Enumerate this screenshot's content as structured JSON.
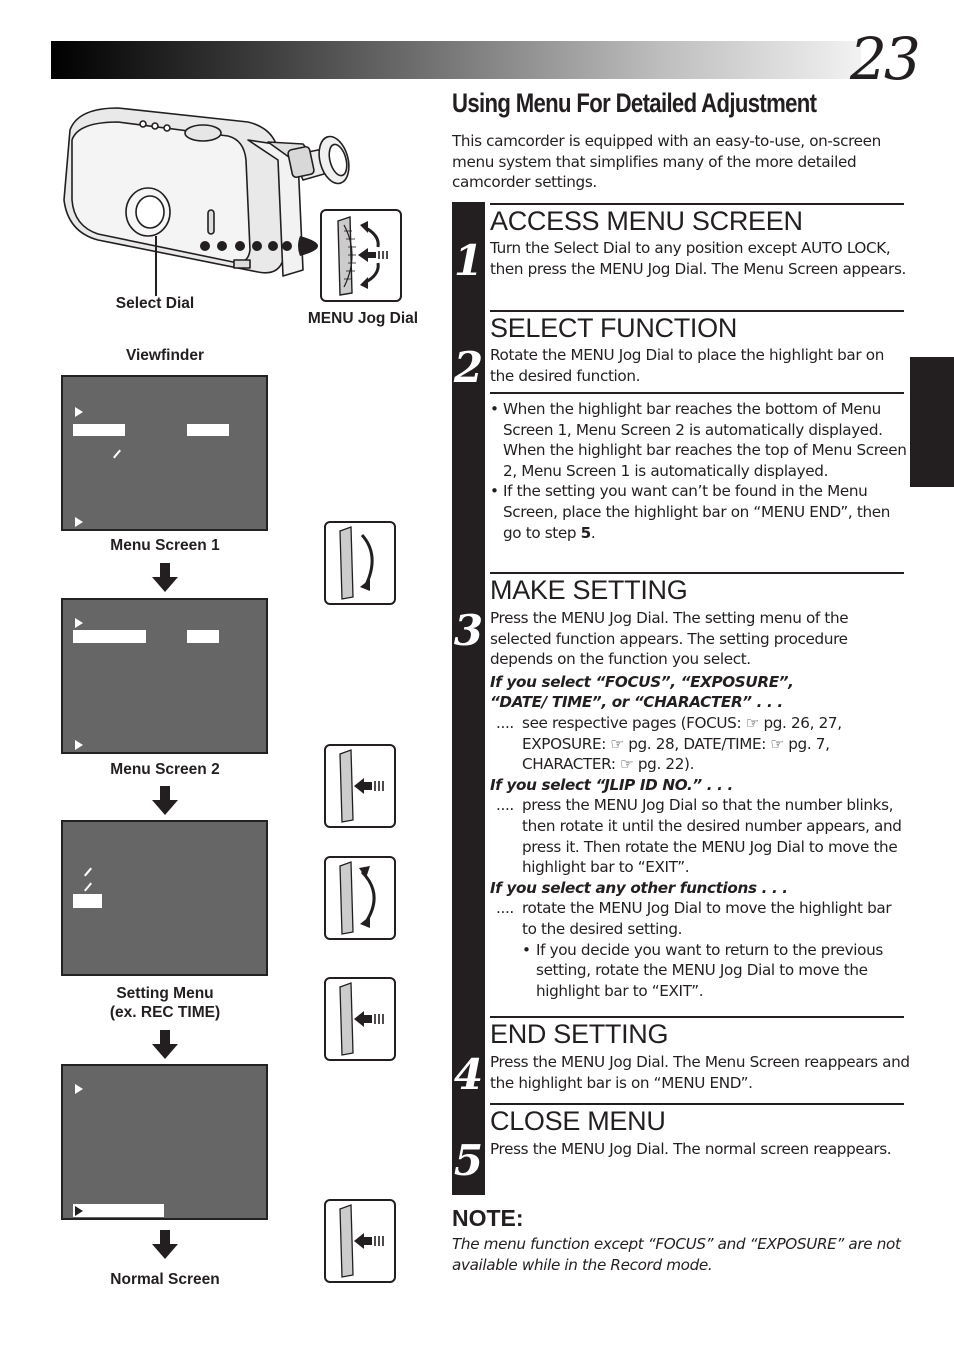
{
  "page": {
    "number": "23",
    "section_title": "Using Menu For Detailed Adjustment",
    "intro": "This camcorder is equipped with an easy-to-use, on-screen menu system that simplifies many of the more detailed camcorder settings."
  },
  "figure": {
    "select_dial_label": "Select Dial",
    "jog_dial_label": "MENU Jog Dial",
    "viewfinder_label": "Viewfinder",
    "screens": [
      {
        "caption": "Menu Screen 1"
      },
      {
        "caption": "Menu Screen 2"
      },
      {
        "caption_line1": "Setting Menu",
        "caption_line2": "(ex. REC TIME)"
      },
      {
        "caption": "Normal Screen"
      }
    ],
    "jog_actions": [
      "rotate-down",
      "press",
      "rotate-both",
      "press",
      "press"
    ]
  },
  "steps": [
    {
      "number": "1",
      "heading": "ACCESS MENU SCREEN",
      "body": "Turn the Select Dial to any position except AUTO LOCK, then press the MENU Jog Dial. The Menu Screen appears."
    },
    {
      "number": "2",
      "heading": "SELECT FUNCTION",
      "body": "Rotate the MENU Jog Dial to place the highlight bar on the desired function.",
      "bullets": [
        "When the highlight bar reaches the bottom of Menu Screen 1, Menu Screen 2 is automatically displayed. When the highlight bar reaches the top of Menu Screen 2, Menu Screen 1 is automatically displayed.",
        "If the setting you want can’t be found in the Menu Screen, place the highlight bar on “MENU END”, then go to step"
      ],
      "bullet_step_ref": "5"
    },
    {
      "number": "3",
      "heading": "MAKE SETTING",
      "body": "Press the MENU Jog Dial. The setting menu of the selected function appears. The setting procedure depends on the function you select.",
      "cases": [
        {
          "condition_line1": "If you select “FOCUS”, “EXPOSURE”,",
          "condition_line2": "“DATE/ TIME”, or “CHARACTER” . . .",
          "lead": "....",
          "text": "see respective pages (FOCUS: ☞ pg. 26, 27, EXPOSURE: ☞ pg. 28, DATE/TIME: ☞ pg. 7, CHARACTER: ☞ pg. 22)."
        },
        {
          "condition_line1": "If you select “JLIP ID NO.” . . .",
          "lead": "....",
          "text": "press the MENU Jog Dial so that the number blinks, then rotate it until the desired number appears, and press it. Then rotate the MENU Jog Dial to move the highlight bar to “EXIT”."
        },
        {
          "condition_line1": "If you select any other functions . . .",
          "lead": "....",
          "text": "rotate the MENU Jog Dial to move the highlight bar to the desired setting.",
          "sub_bullet": "If you decide you want to return to the previous setting, rotate the MENU Jog Dial to move the highlight bar to “EXIT”."
        }
      ]
    },
    {
      "number": "4",
      "heading": "END SETTING",
      "body": "Press the MENU Jog Dial. The Menu Screen reappears and the highlight bar is on “MENU END”."
    },
    {
      "number": "5",
      "heading": "CLOSE MENU",
      "body": "Press the MENU Jog Dial. The normal screen reappears."
    }
  ],
  "note": {
    "label": "NOTE:",
    "text": "The menu function except “FOCUS” and “EXPOSURE” are not available while in the Record mode."
  },
  "colors": {
    "ink": "#231f20",
    "screen_gray": "#666666"
  }
}
